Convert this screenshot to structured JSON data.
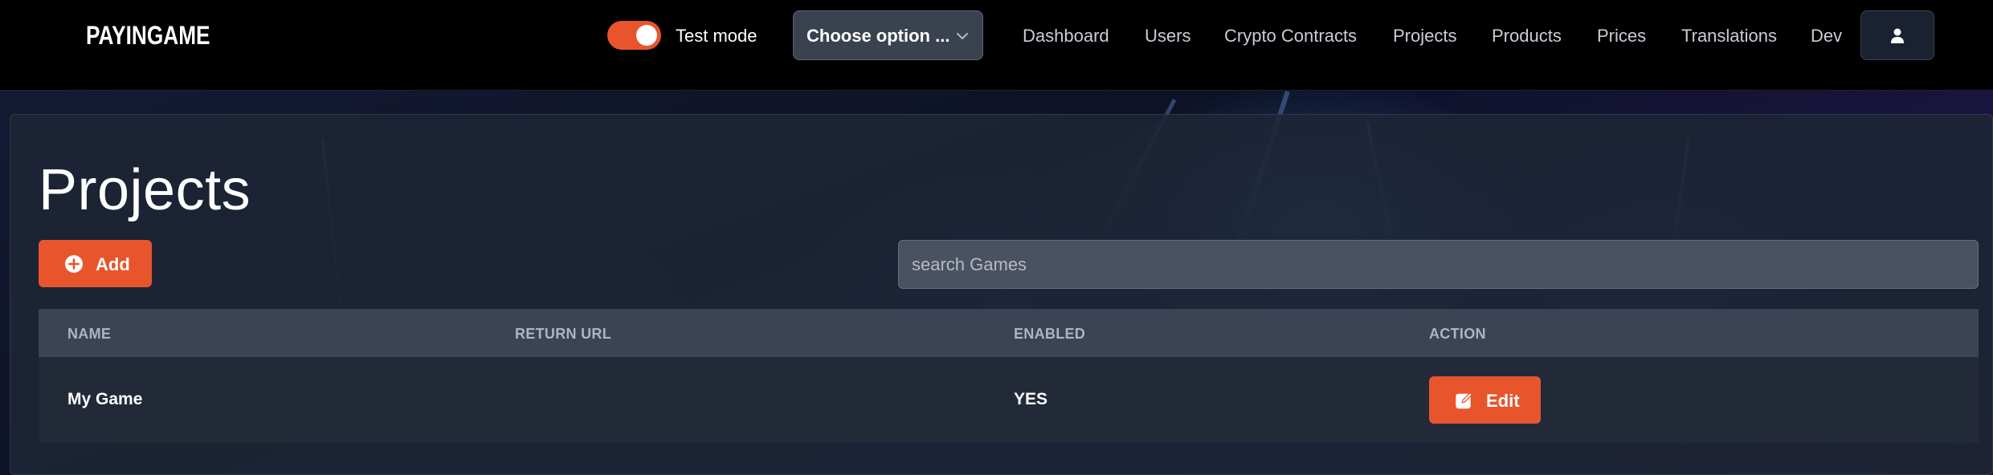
{
  "header": {
    "logo": "PAYINGAME",
    "test_mode_label": "Test mode",
    "test_mode_on": true,
    "select_value": "Choose option ...",
    "nav": [
      "Dashboard",
      "Users",
      "Crypto Contracts",
      "Projects",
      "Products",
      "Prices",
      "Translations",
      "Dev"
    ],
    "user_icon": "user-icon"
  },
  "page": {
    "title": "Projects",
    "add_label": "Add",
    "search_placeholder": "search Games"
  },
  "table": {
    "columns": [
      "NAME",
      "RETURN URL",
      "ENABLED",
      "ACTION"
    ],
    "rows": [
      {
        "name": "My Game",
        "return_url": "",
        "enabled": "YES",
        "action_label": "Edit"
      }
    ]
  },
  "colors": {
    "accent": "#e8552d",
    "header_bg": "#000000",
    "table_head_bg": "#3b4454",
    "row_bg": "#222a38"
  }
}
